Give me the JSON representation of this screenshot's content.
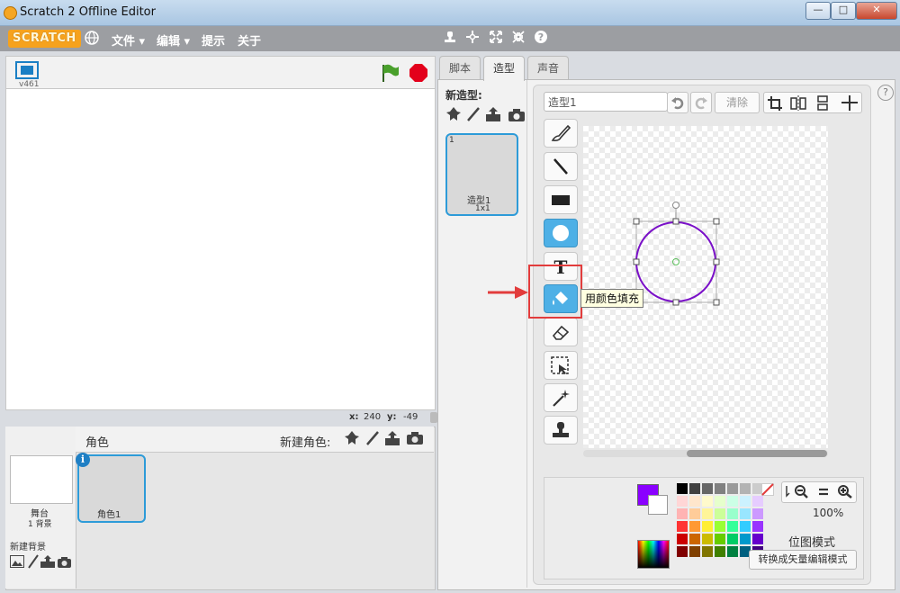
{
  "window": {
    "title": "Scratch 2 Offline Editor",
    "minimize": "—",
    "maximize": "□",
    "close": "✕"
  },
  "menubar": {
    "logo": "SCRATCH",
    "items": [
      "文件 ▾",
      "编辑 ▾",
      "提示",
      "关于"
    ]
  },
  "stage": {
    "version": "v461",
    "x_label": "x:",
    "x_value": "240",
    "y_label": "y:",
    "y_value": "-49"
  },
  "sprites": {
    "header_label": "角色",
    "new_sprite_label": "新建角色:",
    "stage_thumb_label": "舞台",
    "stage_backdrop_count": "1 背景",
    "new_backdrop_label": "新建背景",
    "sprite_items": [
      {
        "name": "角色1"
      }
    ]
  },
  "tabs": [
    {
      "label": "脚本"
    },
    {
      "label": "造型"
    },
    {
      "label": "声音"
    }
  ],
  "costumes": {
    "new_costume_label": "新造型:",
    "items": [
      {
        "index": "1",
        "name": "造型1",
        "size": "1x1"
      }
    ]
  },
  "editor": {
    "costume_name_value": "造型1",
    "clear_label": "清除",
    "help_label": "?",
    "tooltip": "用颜色填充",
    "zoom_level": "100%",
    "mode_label": "位图模式",
    "convert_button_label": "转换成矢量编辑模式",
    "primary_color": "#8a00ff",
    "circle_stroke": "#7a10c8",
    "selected_tool": "fill-bucket"
  },
  "palette": {
    "grays": [
      "#000000",
      "#404040",
      "#666666",
      "#808080",
      "#999999",
      "#b3b3b3",
      "#cccccc"
    ],
    "rows": [
      [
        "#ffd6d6",
        "#ffe6cc",
        "#fffacc",
        "#e6ffcc",
        "#ccffe6",
        "#ccf2ff",
        "#e6ccff"
      ],
      [
        "#ffb3b3",
        "#ffcc99",
        "#fff599",
        "#ccff99",
        "#99ffcc",
        "#99e6ff",
        "#cc99ff"
      ],
      [
        "#ff3333",
        "#ff9933",
        "#ffee33",
        "#99ff33",
        "#33ff99",
        "#33ccff",
        "#9933ff"
      ],
      [
        "#cc0000",
        "#cc6600",
        "#ccbb00",
        "#66cc00",
        "#00cc66",
        "#0099cc",
        "#6600cc"
      ],
      [
        "#800000",
        "#804000",
        "#807500",
        "#408000",
        "#008040",
        "#006080",
        "#400080"
      ]
    ]
  }
}
